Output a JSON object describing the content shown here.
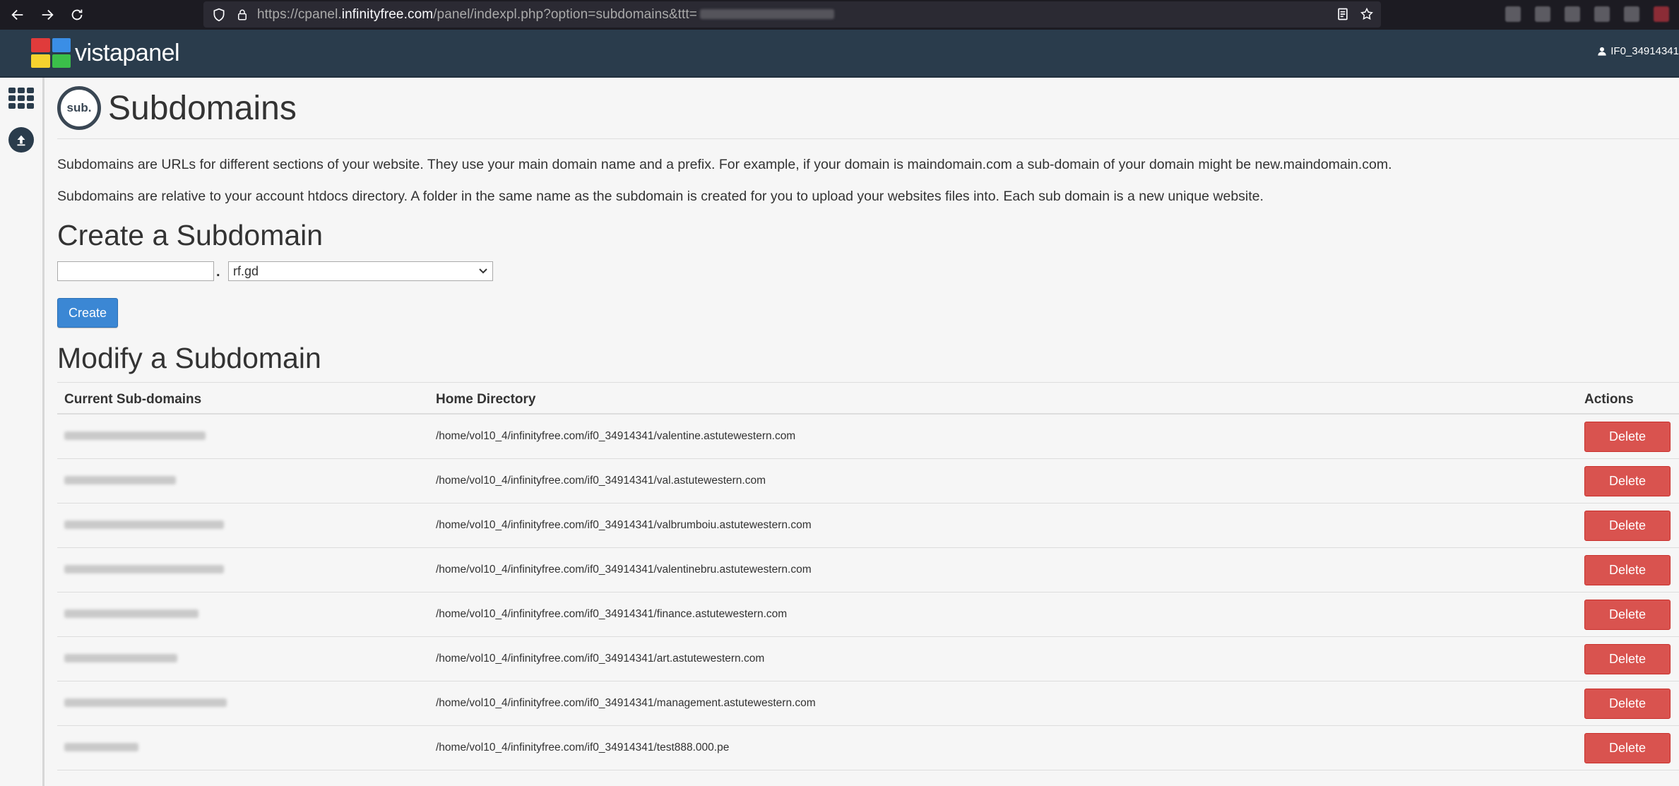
{
  "browser": {
    "url_prefix": "https://cpanel.",
    "url_host": "infinityfree.com",
    "url_suffix": "/panel/indexpl.php?option=subdomains&ttt="
  },
  "header": {
    "logo_text_1": "vista",
    "logo_text_2": "panel",
    "username": "IF0_34914341",
    "logo_colors": [
      "#e03b3b",
      "#3a8ee6",
      "#f5d22e",
      "#3bbf4a"
    ]
  },
  "page": {
    "badge": "sub.",
    "title": "Subdomains",
    "desc1": "Subdomains are URLs for different sections of your website. They use your main domain name and a prefix. For example, if your domain is maindomain.com a sub-domain of your domain might be new.maindomain.com.",
    "desc2": "Subdomains are relative to your account htdocs directory. A folder in the same name as the subdomain is created for you to upload your websites files into. Each sub domain is a new unique website."
  },
  "create": {
    "heading": "Create a Subdomain",
    "input_value": "",
    "separator": ".",
    "selected_domain": "rf.gd",
    "button": "Create"
  },
  "modify": {
    "heading": "Modify a Subdomain",
    "col_sub": "Current Sub-domains",
    "col_dir": "Home Directory",
    "col_actions": "Actions",
    "rows": [
      {
        "dir": "/home/vol10_4/infinityfree.com/if0_34914341/valentine.astutewestern.com",
        "action": "Delete"
      },
      {
        "dir": "/home/vol10_4/infinityfree.com/if0_34914341/val.astutewestern.com",
        "action": "Delete"
      },
      {
        "dir": "/home/vol10_4/infinityfree.com/if0_34914341/valbrumboiu.astutewestern.com",
        "action": "Delete"
      },
      {
        "dir": "/home/vol10_4/infinityfree.com/if0_34914341/valentinebru.astutewestern.com",
        "action": "Delete"
      },
      {
        "dir": "/home/vol10_4/infinityfree.com/if0_34914341/finance.astutewestern.com",
        "action": "Delete"
      },
      {
        "dir": "/home/vol10_4/infinityfree.com/if0_34914341/art.astutewestern.com",
        "action": "Delete"
      },
      {
        "dir": "/home/vol10_4/infinityfree.com/if0_34914341/management.astutewestern.com",
        "action": "Delete"
      },
      {
        "dir": "/home/vol10_4/infinityfree.com/if0_34914341/test888.000.pe",
        "action": "Delete"
      }
    ]
  }
}
